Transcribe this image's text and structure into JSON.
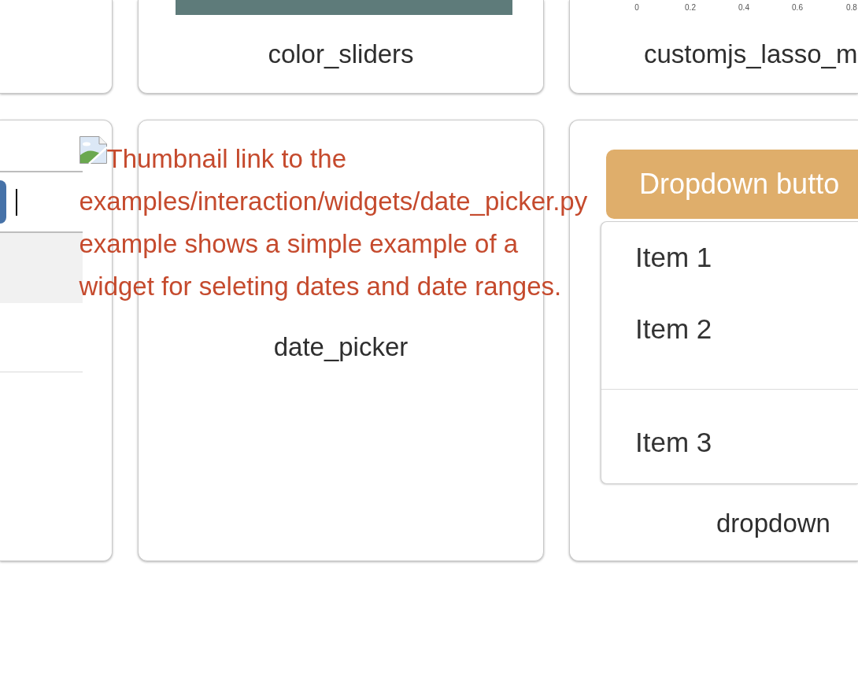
{
  "cards_top": [
    {
      "kind": "blank"
    },
    {
      "kind": "swatch",
      "label": "color_sliders"
    },
    {
      "kind": "plot",
      "axis_ticks": [
        "0",
        "0.2",
        "0.4",
        "0.6",
        "0.8"
      ],
      "label": "customjs_lasso_m"
    }
  ],
  "cards_bottom": [
    {
      "kind": "text_input"
    },
    {
      "kind": "broken_thumbnail",
      "alt_text_lines": [
        "Thumbnail link to the",
        "examples/interaction/widgets/date_picker.py",
        "example shows a simple example of a",
        "widget for seleting dates and date ranges."
      ],
      "label": "date_picker"
    },
    {
      "kind": "dropdown",
      "button": "Dropdown butto",
      "menu": [
        {
          "kind": "item",
          "label": "Item 1"
        },
        {
          "kind": "item",
          "label": "Item 2"
        },
        {
          "kind": "divider"
        },
        {
          "kind": "item",
          "label": "Item 3"
        }
      ],
      "label": "dropdown"
    }
  ]
}
